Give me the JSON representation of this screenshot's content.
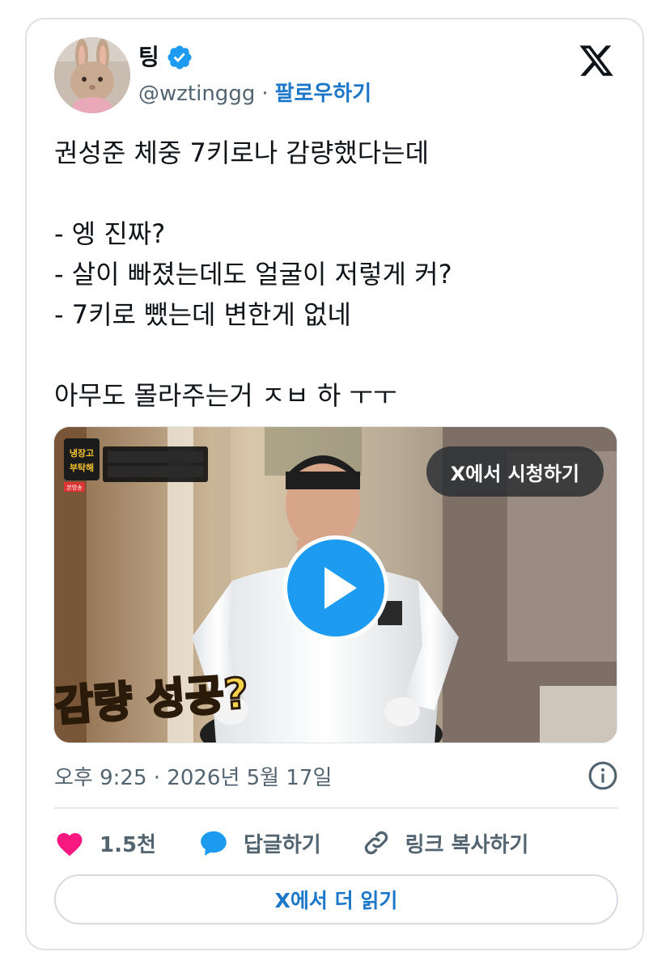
{
  "tweet": {
    "author": {
      "name": "팅",
      "handle": "@wztinggg",
      "separator": "·",
      "follow_label": "팔로우하기",
      "verified_color": "#1d9bf0"
    },
    "text": "권성준 체중 7키로나 감량했다는데\n\n- 엥 진짜?\n- 살이 빠졌는데도 얼굴이 저렇게 커?\n- 7키로 뺐는데 변한게 없네\n\n아무도 몰라주는거 ㅈㅂ 하 ㅜㅜ",
    "media": {
      "watch_label": "X에서 시청하기",
      "overlay_caption": "감량 성공?",
      "show_logo_text": "냉장고를 부탁해",
      "broadcast_tag": "본방송"
    },
    "timestamp": "오후 9:25 · 2026년 5월 17일",
    "actions": {
      "like_count": "1.5천",
      "reply_label": "답글하기",
      "copy_link_label": "링크 복사하기"
    },
    "read_more_label": "X에서 더 읽기"
  },
  "colors": {
    "like_heart": "#f91880",
    "reply_bubble": "#1d9bf0",
    "link_accent": "#1d77c8",
    "muted_text": "#536471"
  },
  "icons": [
    "verified-badge-icon",
    "x-logo-icon",
    "play-icon",
    "info-icon",
    "heart-icon",
    "reply-bubble-icon",
    "link-icon"
  ]
}
